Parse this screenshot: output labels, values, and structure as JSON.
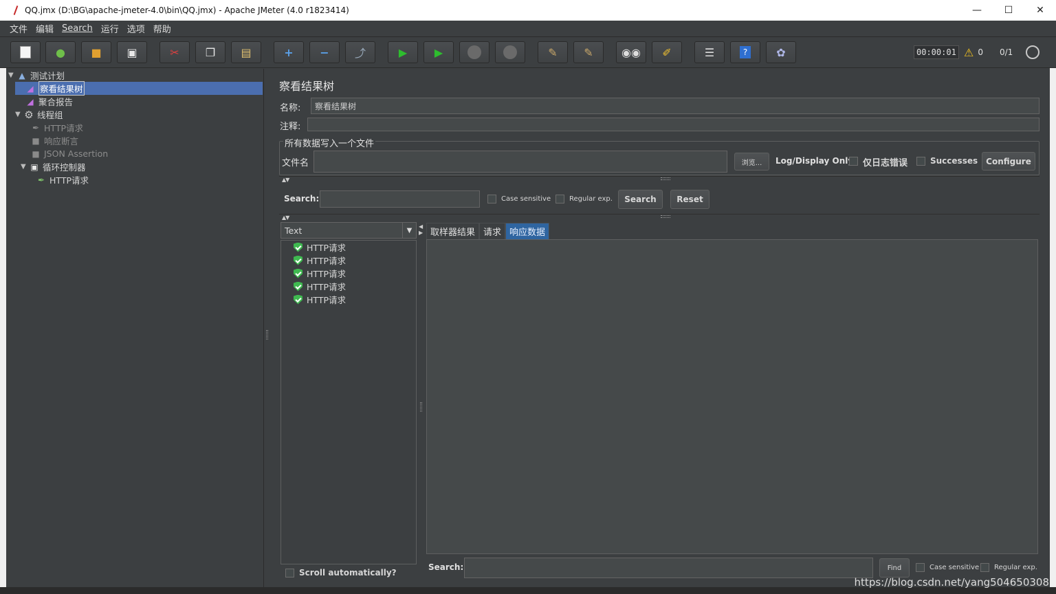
{
  "window": {
    "title": "QQ.jmx (D:\\BG\\apache-jmeter-4.0\\bin\\QQ.jmx) - Apache JMeter (4.0 r1823414)",
    "minimize": "—",
    "maximize": "☐",
    "close": "✕"
  },
  "menu": [
    "文件",
    "编辑",
    "Search",
    "运行",
    "选项",
    "帮助"
  ],
  "toolbar": {
    "timer": "00:00:01",
    "warning_count": "0",
    "threads": "0/1"
  },
  "tree": [
    {
      "label": "测试计划",
      "icon": "test-plan-icon"
    },
    {
      "label": "察看结果树",
      "icon": "chart-icon"
    },
    {
      "label": "聚合报告",
      "icon": "chart-icon"
    },
    {
      "label": "线程组",
      "icon": "gear-icon"
    },
    {
      "label": "HTTP请求",
      "icon": "pipette-icon"
    },
    {
      "label": "响应断言",
      "icon": "assertion-icon"
    },
    {
      "label": "JSON Assertion",
      "icon": "assertion-icon"
    },
    {
      "label": "循环控制器",
      "icon": "controller-icon"
    },
    {
      "label": "HTTP请求",
      "icon": "pipette-icon"
    }
  ],
  "panel": {
    "title": "察看结果树",
    "name_label": "名称:",
    "name_value": "察看结果树",
    "comment_label": "注释:",
    "fieldset_legend": "所有数据写入一个文件",
    "filename_label": "文件名",
    "browse_button": "浏览...",
    "log_display_only": "Log/Display Only:",
    "errors_only": "仅日志错误",
    "successes": "Successes",
    "configure": "Configure"
  },
  "search": {
    "label": "Search:",
    "case_sensitive": "Case sensitive",
    "regular_exp": "Regular exp.",
    "search_button": "Search",
    "reset_button": "Reset"
  },
  "results": {
    "renderer": "Text",
    "items": [
      "HTTP请求",
      "HTTP请求",
      "HTTP请求",
      "HTTP请求",
      "HTTP请求"
    ],
    "scroll_auto": "Scroll automatically?",
    "tabs": [
      "取样器结果",
      "请求",
      "响应数据"
    ]
  },
  "bottom_search": {
    "label": "Search:",
    "find_button": "Find",
    "case_sensitive": "Case sensitive",
    "regular_exp": "Regular exp."
  },
  "watermark": "https://blog.csdn.net/yang504650308"
}
